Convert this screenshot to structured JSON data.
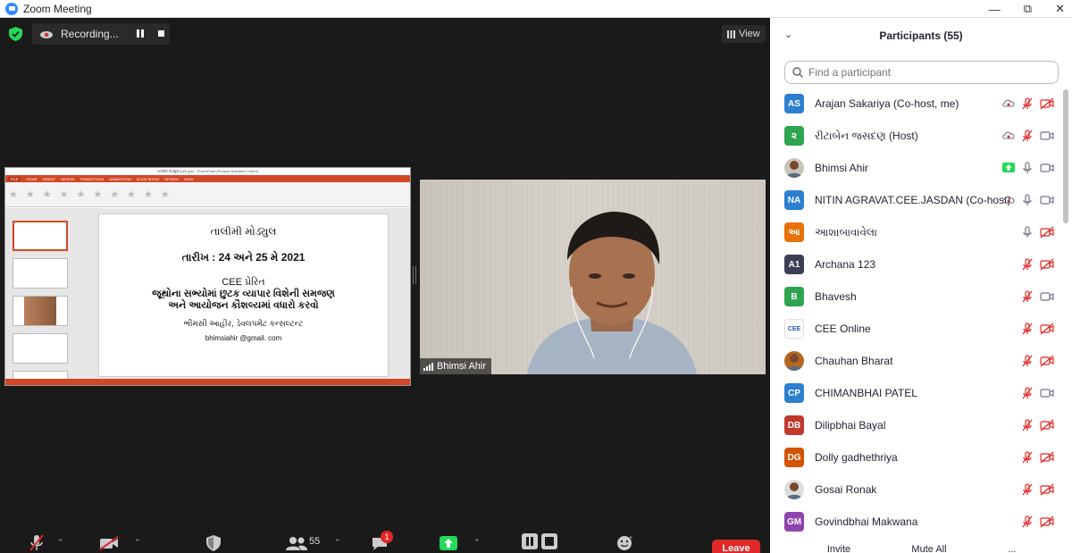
{
  "window": {
    "title": "Zoom Meeting"
  },
  "topbar": {
    "recording_label": "Recording...",
    "view_label": "View"
  },
  "share": {
    "ppt_window_title": "તાલીમી મોડ્યુલ ઇડર.pptx - PowerPoint (Product Activation Failed)",
    "ppt_tabs": [
      "FILE",
      "HOME",
      "INSERT",
      "DESIGN",
      "TRANSITIONS",
      "ANIMATIONS",
      "SLIDE SHOW",
      "REVIEW",
      "VIEW"
    ],
    "slide": {
      "line1": "તાલીમી મોડ્યુલ",
      "line2": "તારીખ : 24 અને 25 મે 2021",
      "line3": "CEE પ્રેરિત",
      "line4": "જૂથોના સભ્યોમાં છુટક વ્યાપાર વિશેની સમજણ",
      "line5": "અને આયોજન કૌશલ્યમાં વધારો કરવો",
      "line6": "ભીમસી આહીર, ડેવલપમેંટ કન્સલ્ટન્ટ",
      "line7": "bhimsiahir @gmail. com"
    }
  },
  "video": {
    "name": "Bhimsi Ahir"
  },
  "toolbar": {
    "participants_count": "55",
    "chat_badge": "1",
    "leave_label": "Leave"
  },
  "panel": {
    "title": "Participants (55)",
    "search_placeholder": "Find a participant",
    "invite_label": "Invite",
    "mute_all_label": "Mute All",
    "more_label": "..."
  },
  "participants": [
    {
      "initials": "AS",
      "name": "Arajan Sakariya (Co-host, me)",
      "color": "#2d7fd0",
      "mic": "muted",
      "video": "off",
      "cloud": true
    },
    {
      "initials": "૨",
      "name": "રીટાબેન જસદણ (Host)",
      "color": "#2ea44f",
      "mic": "muted",
      "video": "on",
      "cloud": true
    },
    {
      "initials": "",
      "name": "Bhimsi Ahir",
      "color": "#c9c4bb",
      "mic": "on",
      "video": "on",
      "sharing": true
    },
    {
      "initials": "NA",
      "name": "NITIN AGRAVAT.CEE.JASDAN (Co-host)",
      "color": "#2d7fd0",
      "mic": "on",
      "video": "on",
      "cloud": true
    },
    {
      "initials": "આ",
      "name": "આશાબાવાવેલા",
      "color": "#e8710a",
      "mic": "on",
      "video": "off"
    },
    {
      "initials": "A1",
      "name": "Archana 123",
      "color": "#3d3d56",
      "mic": "muted",
      "video": "off"
    },
    {
      "initials": "B",
      "name": "Bhavesh",
      "color": "#2ea44f",
      "mic": "muted",
      "video": "on"
    },
    {
      "initials": "CEE",
      "name": "CEE Online",
      "color": "#ffffff",
      "mic": "muted",
      "video": "off"
    },
    {
      "initials": "",
      "name": "Chauhan Bharat",
      "color": "#b5651d",
      "mic": "muted",
      "video": "off"
    },
    {
      "initials": "CP",
      "name": "CHIMANBHAI PATEL",
      "color": "#2d7fd0",
      "mic": "muted",
      "video": "on"
    },
    {
      "initials": "DB",
      "name": "Dilipbhai Bayal",
      "color": "#c0392b",
      "mic": "muted",
      "video": "off"
    },
    {
      "initials": "DG",
      "name": "Dolly gadhethriya",
      "color": "#d35400",
      "mic": "muted",
      "video": "off"
    },
    {
      "initials": "",
      "name": "Gosai Ronak",
      "color": "#dddddd",
      "mic": "muted",
      "video": "off"
    },
    {
      "initials": "GM",
      "name": "Govindbhai Makwana",
      "color": "#8e44ad",
      "mic": "muted",
      "video": "off"
    }
  ]
}
